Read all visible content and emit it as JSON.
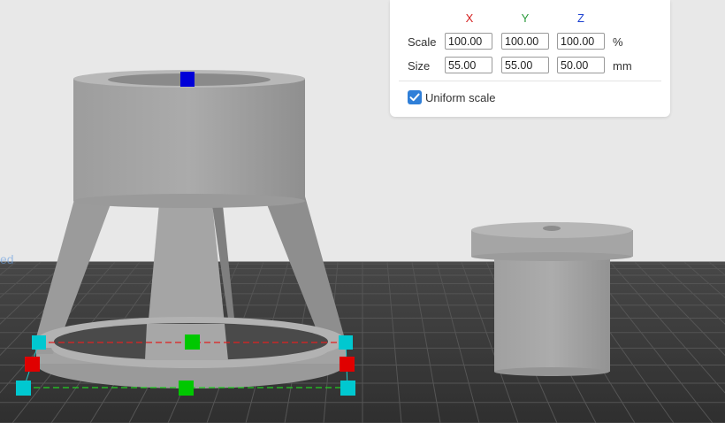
{
  "scale_panel": {
    "axis_labels": {
      "x": "X",
      "y": "Y",
      "z": "Z"
    },
    "axis_colors": {
      "x": "#d42020",
      "y": "#2a9a3a",
      "z": "#1a3fd0"
    },
    "scale": {
      "label": "Scale",
      "x": "100.00",
      "y": "100.00",
      "z": "100.00",
      "unit": "%"
    },
    "size": {
      "label": "Size",
      "x": "55.00",
      "y": "55.00",
      "z": "50.00",
      "unit": "mm"
    },
    "uniform_scale": {
      "label": "Uniform scale",
      "checked": true
    }
  },
  "viewport": {
    "bed_color": "#3a3a3a",
    "model_color": "#a6a6a6",
    "gizmo_handle_colors": {
      "x": "#e00000",
      "y": "#00c800",
      "z": "#0000d8",
      "corner": "#00c8d0"
    }
  }
}
